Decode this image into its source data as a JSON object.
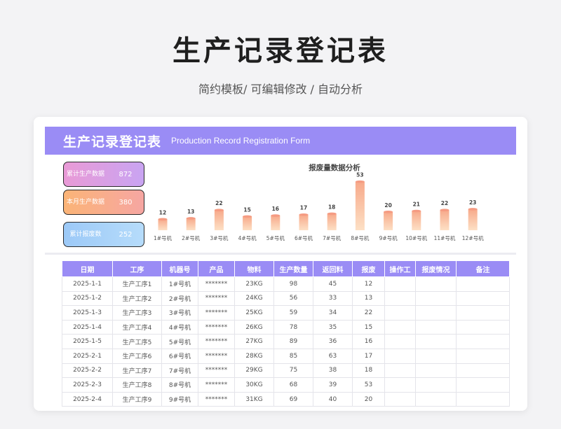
{
  "hero": {
    "title": "生产记录登记表",
    "subtitle": "简约模板/  可编辑修改  / 自动分析"
  },
  "banner": {
    "title": "生产记录登记表",
    "subtitle_en": "Production Record Registration Form"
  },
  "stats": [
    {
      "label": "累计生产数据",
      "value": "872"
    },
    {
      "label": "本月生产数据",
      "value": "380"
    },
    {
      "label": "累计报废数",
      "value": "252"
    }
  ],
  "colors": {
    "accent": "#9a8cf5",
    "bar_top": "#f7a98a",
    "bar_bottom": "#fde0c5"
  },
  "chart_data": {
    "type": "bar",
    "title": "报废量数据分析",
    "categories": [
      "1#号机",
      "2#号机",
      "3#号机",
      "4#号机",
      "5#号机",
      "6#号机",
      "7#号机",
      "8#号机",
      "9#号机",
      "10#号机",
      "11#号机",
      "12#号机"
    ],
    "values": [
      12,
      13,
      22,
      15,
      16,
      17,
      18,
      53,
      20,
      21,
      22,
      23
    ],
    "ylim": [
      0,
      55
    ],
    "grid": false,
    "legend": "none"
  },
  "table": {
    "headers": [
      "日期",
      "工序",
      "机器号",
      "产品",
      "物料",
      "生产数量",
      "返回料",
      "报废",
      "操作工",
      "报废情况",
      "备注"
    ],
    "rows": [
      [
        "2025-1-1",
        "生产工序1",
        "1#号机",
        "*******",
        "23KG",
        "98",
        "45",
        "12",
        "",
        "",
        ""
      ],
      [
        "2025-1-2",
        "生产工序2",
        "2#号机",
        "*******",
        "24KG",
        "56",
        "33",
        "13",
        "",
        "",
        ""
      ],
      [
        "2025-1-3",
        "生产工序3",
        "3#号机",
        "*******",
        "25KG",
        "59",
        "34",
        "22",
        "",
        "",
        ""
      ],
      [
        "2025-1-4",
        "生产工序4",
        "4#号机",
        "*******",
        "26KG",
        "78",
        "35",
        "15",
        "",
        "",
        ""
      ],
      [
        "2025-1-5",
        "生产工序5",
        "5#号机",
        "*******",
        "27KG",
        "89",
        "36",
        "16",
        "",
        "",
        ""
      ],
      [
        "2025-2-1",
        "生产工序6",
        "6#号机",
        "*******",
        "28KG",
        "85",
        "63",
        "17",
        "",
        "",
        ""
      ],
      [
        "2025-2-2",
        "生产工序7",
        "7#号机",
        "*******",
        "29KG",
        "75",
        "38",
        "18",
        "",
        "",
        ""
      ],
      [
        "2025-2-3",
        "生产工序8",
        "8#号机",
        "*******",
        "30KG",
        "68",
        "39",
        "53",
        "",
        "",
        ""
      ],
      [
        "2025-2-4",
        "生产工序9",
        "9#号机",
        "*******",
        "31KG",
        "69",
        "40",
        "20",
        "",
        "",
        ""
      ]
    ]
  }
}
